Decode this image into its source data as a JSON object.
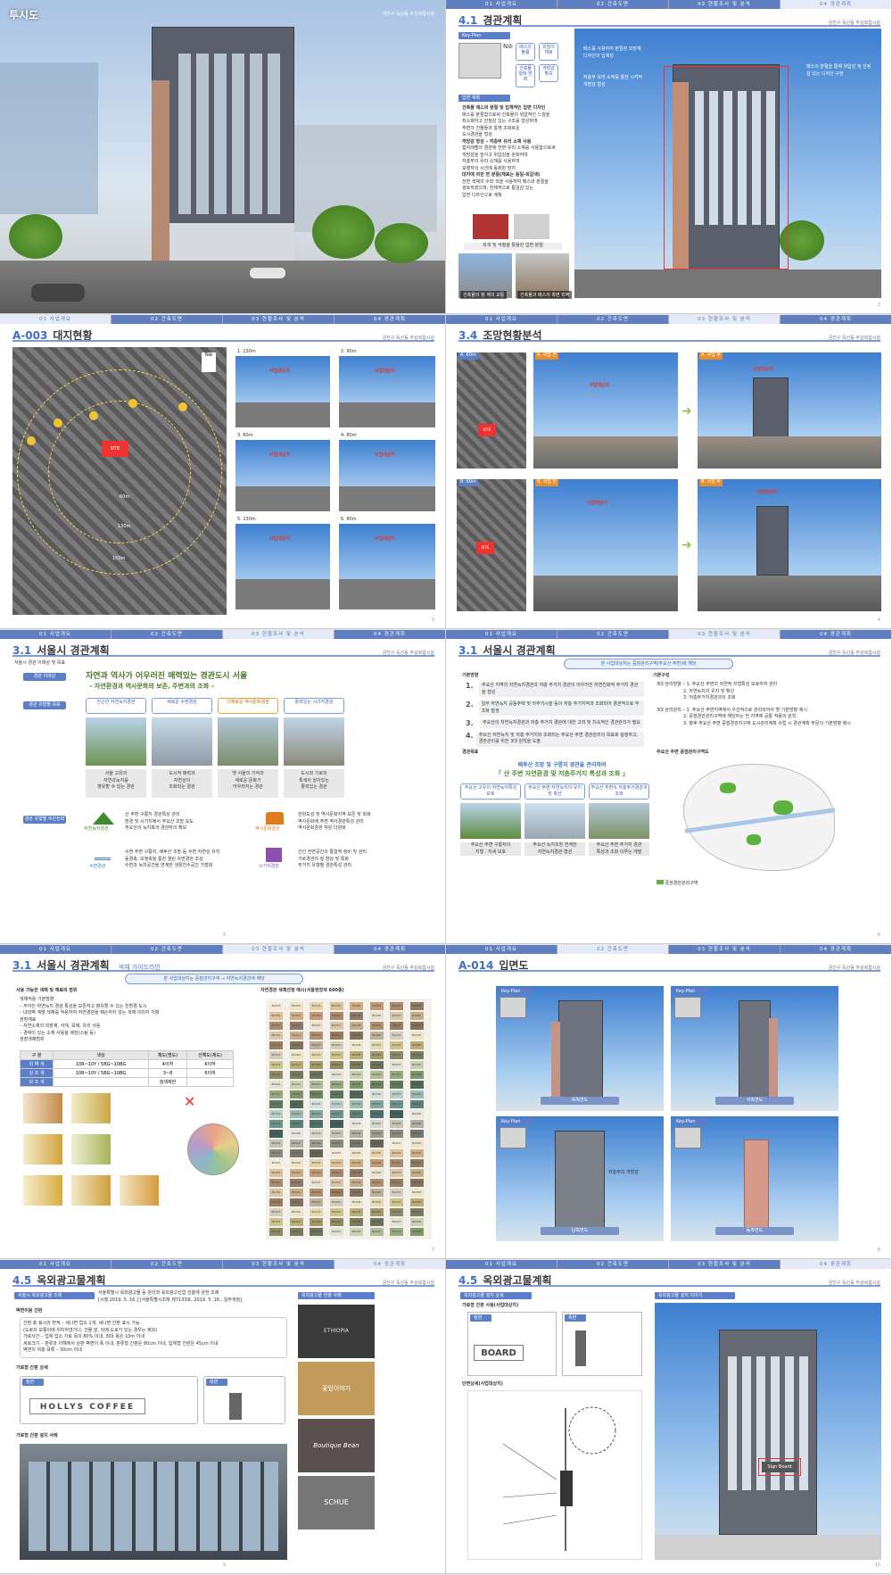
{
  "nav": [
    "01 사업개요",
    "02 건축도면",
    "03 현황조사 및 분석",
    "04 경관계획"
  ],
  "project": "금천구 독산동 주상복합시설",
  "p1": {
    "title": "투시도",
    "project": "금천구 독산동 주상복합시설"
  },
  "p2": {
    "num": "4.1",
    "title": "경관계획",
    "page": "2",
    "keyplan": "Key-Plan",
    "pills": [
      "매스의 볼륨",
      "외장의 재료",
      "건축물 형태 변화",
      "개방감 확보"
    ],
    "section": "입면 계획",
    "lines": [
      "건축물 매스의 분절 및 입체적인 입면 디자인",
      "매스를 분절함으로써 건축물의 위압적인 느낌을",
      "최소화하고 안정감 있는 구조를 형성하며",
      "주변의 건물들과 함께 조화로운",
      "도시경관을 형성",
      "개방감 형성 – 저층부 유리 소재 사용",
      "접지레벨의 경관에 전면 유리 소재를 사용함으로써",
      "개방감을 높이고 위압감을 완화하며",
      "저층부의 유리 소재를 사용하여",
      "보행자의 시선에 동화된 방지",
      "대지에 의한 면 분절(재료는 동일-회갈색)",
      "전면 색채의 수와 색을 사용하여 매스와 분절을",
      "검토하였으며, 전체적으로 통일감 있는",
      "입면 디자인으로 계획"
    ],
    "matcap": "회색 및 석질을 활용한 입면 분절",
    "cap1": "건축물의 창 계의 교통",
    "cap2": "건축물과 매스의 측면 외벽",
    "ann1": "매스를 사용하여 분절된 외장재 디자인의 입체성",
    "ann2": "저층부 유리 소재를 통한 시각적 개방감 형성",
    "ann3": "매스의 분절을 통해 위압감 및 안정감 있는 디자인 구현"
  },
  "p3": {
    "num": "A-003",
    "title": "대지현황",
    "page": "3",
    "views": [
      [
        "1.",
        "130m"
      ],
      [
        "2.",
        "90m"
      ],
      [
        "3.",
        "60m"
      ],
      [
        "4.",
        "80m"
      ],
      [
        "5.",
        "130m"
      ],
      [
        "6.",
        "80m"
      ]
    ],
    "target": "사업대상지",
    "site": "SITE",
    "rings": [
      "60m",
      "130m",
      "150m"
    ]
  },
  "p4": {
    "num": "3.4",
    "title": "조망현황분석",
    "page": "4",
    "a": "A. 60m",
    "b": "B. 60m",
    "before": "A. 사업 전",
    "after": "A. 사업 후",
    "before_b": "B. 사업 전",
    "after_b": "B. 사업 후",
    "target": "사업대상지",
    "site": "SITE"
  },
  "p5": {
    "num": "3.1",
    "title": "서울시 경관계획",
    "page": "5",
    "intro": "서울시 경관 이래상 및 목표",
    "l1": "경관 이래상",
    "l2": "경관 유형별 목표",
    "l3": "경관 유형별 추진전략",
    "slogan1": "자연과 역사가 어우러진 매력있는 경관도시 서울",
    "slogan2": "– 자연환경과 역사문화의 보존, 주변과의 조화 –",
    "types": [
      "친근한 자연녹지경관",
      "새로운 수변경관",
      "다채로운 역사문화경관",
      "활력있는 시가지경관"
    ],
    "desc": [
      [
        "서울 고유의",
        "자연과녹지를",
        "향유할 수 있는 경관"
      ],
      [
        "도시적 매력과",
        "자연성이",
        "조화되는 경관"
      ],
      [
        "옛 서울의 기억과",
        "새로운 문화가",
        "어우러지는 경관"
      ],
      [
        "도시와 기로의",
        "특색이 살아있는",
        "활력있는 경관"
      ]
    ],
    "s1": [
      "산 주변 구릉지 경관특성 관리",
      "환경 및 시가지에서 주요산 조망 요도",
      "주요산의 녹지축과 경관하의 확보"
    ],
    "s2": [
      "한양도성 및 역사문화지역 보존 및 회복",
      "역사문화에 주변 역사경관특성 관리",
      "역사문화경관 자원 다양화"
    ],
    "s3": [
      "수변 주변 구릉지, 배후산 조망 등 수변 자연성 유지",
      "동경축, 보행축을 통한 열린 수변경관 조성",
      "수변과 녹지공간을 연계한 생활친수공간 거점화"
    ],
    "s4": [
      "간선 전면공간의 통합적 정비 및 관리",
      "가로경관의 질 향상 및 특화",
      "주거지 유형별 경관특성 관리"
    ],
    "icons": [
      "자연녹지경관",
      "역사문화경관",
      "수변경관",
      "시가지경관"
    ]
  },
  "p6": {
    "num": "3.1",
    "title": "서울시 경관계획",
    "page": "6",
    "banner": "본 사업대상지는 중점관리구역(주요산 주변)에 해당",
    "basic": "기본방향",
    "struct": "기본구성",
    "plan": "경관목표",
    "steps": [
      "주요산 지역의 자연녹지경관과 저층 주거지 경관이 어우러진 자연친화적 주거지 경관을 형성",
      "일부 자연녹지 공동주택 및 아주거시설 등이 저층 주거지역과 조화되어 경관적으로 부조화 발생",
      "주요산의 자연녹지경관과 저층 주거지 경관에 대한 고려 및 지속적인 경관관리가 필요",
      "주요산 자연녹지 및 저층 주거지와 조화되는 주요산 주변 경관관리의 목표로 설정하고, 경관관리를 위한 3대 원칙을 도출"
    ],
    "goal1": "배후산 조망 및 구릉지 경관을 관리하여",
    "goal2": "「 산 주변 자연환경 및 저층주거지 특성과 조화 」",
    "cats": [
      "주요산 고유의 자연녹지특성 보호",
      "주요산 주변 자연녹지의 유지 및 확산",
      "주요산 주변의 저층주거경관과 조화"
    ],
    "cdesc": [
      [
        "주요산 주변 구릉지의",
        "지형 · 지세 보호"
      ],
      [
        "주요산 녹지조망 연계한",
        "자연녹지경관 형성"
      ],
      [
        "주요산 주변 주거지 경관",
        "특성과 조화 이루는 개발"
      ]
    ],
    "struct1": [
      "3대 관리방향 – 1. 주요산 주변의 자연적 지형특성 보호하여 관리",
      "2. 자연녹지의 유지 및 확산",
      "3. 저층주거지경관과의 조화"
    ],
    "struct2": [
      "3대 관리원칙 – 1. 주요산 주변지역에서 우선적으로 관리되어야 할 기본방향 제시",
      "2. 중점경관관리구역에 해당하는 전 지역에 공통 적용의 원칙",
      "3. 향후 주요산 주변 중점경관지구에 도시관리계획 수립 시 경관계획 부문의 기본방향 제시"
    ],
    "map": "주요산 주변 중점관리구역도",
    "legend": "중점경관관리구역"
  },
  "p7": {
    "num": "3.1",
    "title": "서울시 경관계획",
    "sub": "_ 색채 가이드라인",
    "page": "7",
    "banner": "본 사업대상지는 중점관리구역 → 자연녹지경관에 해당",
    "h1": "사용 가능한 색채 및 재료의 범위",
    "h2": "자연경관 색채선정 예시(서울현장색 600종)",
    "notes": [
      "색채적용 기본방향",
      "– 주어진 자연녹지 경관 특성을 보존하고 향유할 수 있는 친환경 도시",
      "– 내외벽 계열 색채를 적용하여 자연경관을 훼손하지 않는 색채 이미지 지향",
      "권장재료",
      "– 자연소재의 외장재, 석재, 목재, 유리 사용",
      "– 경박이 있는 소재 사용을 제한(스팀 등)",
      "권장색채범위"
    ],
    "th": [
      "구 분",
      "색상",
      "채도(명도)",
      "선해도(제도)"
    ],
    "rows": [
      [
        "외 벽 색",
        "10R~10Y / 5BG~10BG",
        "4이하",
        "6이하"
      ],
      [
        "강 조 색",
        "10R~10Y / 5BG~10BG",
        "3~8",
        "6이하"
      ],
      [
        "보 조 색",
        "",
        "검색제한",
        ""
      ]
    ],
    "codes": [
      "BC001",
      "BC002",
      "BC003",
      "BC004",
      "BC005",
      "BC006",
      "BC007",
      "BC008"
    ]
  },
  "p8": {
    "num": "A-014",
    "title": "입면도",
    "page": "8",
    "keyplan": "Key-Plan",
    "elev": [
      "북측면도",
      "서측면도",
      "남측면도",
      "동측면도"
    ],
    "note": "저층부의 개방감"
  },
  "p9": {
    "num": "4.5",
    "title": "옥외광고물계획",
    "page": "9",
    "b1": "서울시 옥외광고물 조례",
    "rule": "서울특별시 옥외광고물 등 관리와 옥외광고산업 진흥에 관한 조례",
    "rule2": "[시행 2019. 5. 16.] [서울특별시조례 제7133호, 2019. 5. 16., 일부개정]",
    "h1": "벽면이용 간판",
    "h2": "가로형 간판 상세",
    "h3": "가로형 간판 설치 사례",
    "b2": "옥외광고물 연출 사례",
    "items": [
      "간판 총 표시의 면적 – 세나면 업소 1개, 세나면 간판 표시 가능",
      "(도로의 모퉁이에 위치하였거나, 건물 앞, 뒤에 도로가 있는 경우는 제외)",
      "가로사간 – 업에 업소 가로 목의 80% 이내, 최대 폭은 10m 이내",
      "세로크기 – 판류과 이해에서 상판 벽면의 폭 이내, 판류형 간판은 80cm 이내, 입체형 간판은 45cm 이내",
      "벽면의 저층 목록 – 30cm 이내"
    ],
    "front": "정면",
    "side": "측면",
    "sign": "HOLLYS COFFEE",
    "brands": [
      "ETHIOPIA",
      "꽃잎이야기",
      "Boutique Bean",
      "SCHUE"
    ]
  },
  "p10": {
    "num": "4.5",
    "title": "옥외광고물계획",
    "page": "10",
    "b1": "옥외광고물 설치 상세",
    "b2": "옥외광고물 설치 이미지",
    "h1": "가로형 간판 사용(사업대상지)",
    "h2": "단면상세(사업대상지)",
    "front": "정면",
    "side": "측면",
    "sign": "BOARD",
    "insitu": "Sign Board"
  }
}
